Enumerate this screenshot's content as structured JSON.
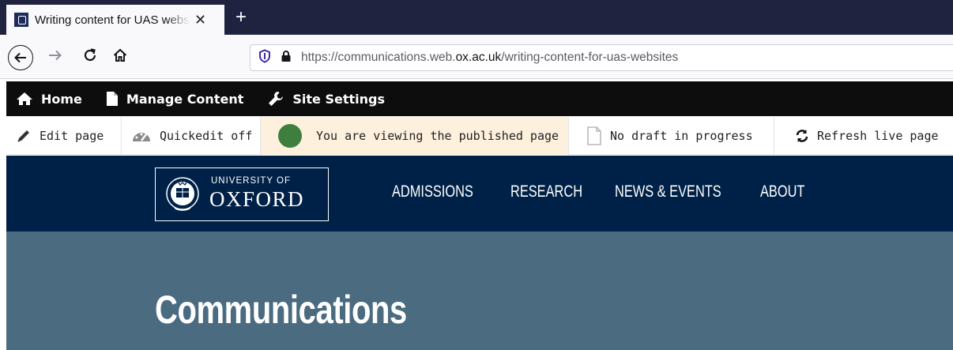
{
  "browser": {
    "tab": {
      "title": "Writing content for UAS websites",
      "close_icon": "close-icon"
    },
    "new_tab_icon": "plus-icon",
    "nav": {
      "back_icon": "arrow-left-icon",
      "forward_icon": "arrow-right-icon",
      "reload_icon": "reload-icon",
      "home_icon": "home-icon"
    },
    "url": {
      "shield_icon": "shield-icon",
      "lock_icon": "lock-icon",
      "prefix": "https://communications.web.",
      "domain": "ox.ac.uk",
      "path": "/writing-content-for-uas-websites"
    }
  },
  "admin_toolbar": {
    "items": [
      {
        "label": "Home",
        "icon": "home-icon"
      },
      {
        "label": "Manage Content",
        "icon": "document-icon"
      },
      {
        "label": "Site Settings",
        "icon": "wrench-icon"
      }
    ]
  },
  "edit_toolbar": {
    "edit": {
      "label": "Edit page",
      "icon": "pencil-icon"
    },
    "quickedit": {
      "label": "Quickedit off",
      "icon": "gauge-icon"
    },
    "status": {
      "label": "You are viewing the published page",
      "indicator_color": "#3e7f3e"
    },
    "draft": {
      "label": "No draft in progress",
      "icon": "blank-document-icon"
    },
    "refresh": {
      "label": "Refresh live page",
      "icon": "refresh-icon"
    }
  },
  "site_header": {
    "logo": {
      "line1": "UNIVERSITY OF",
      "line2": "OXFORD",
      "crest_icon": "oxford-crest-icon"
    },
    "nav": [
      {
        "label": "ADMISSIONS"
      },
      {
        "label": "RESEARCH"
      },
      {
        "label": "NEWS & EVENTS"
      },
      {
        "label": "ABOUT"
      }
    ],
    "background": "#002147"
  },
  "hero": {
    "title": "Communications",
    "background": "#4a6b80"
  }
}
